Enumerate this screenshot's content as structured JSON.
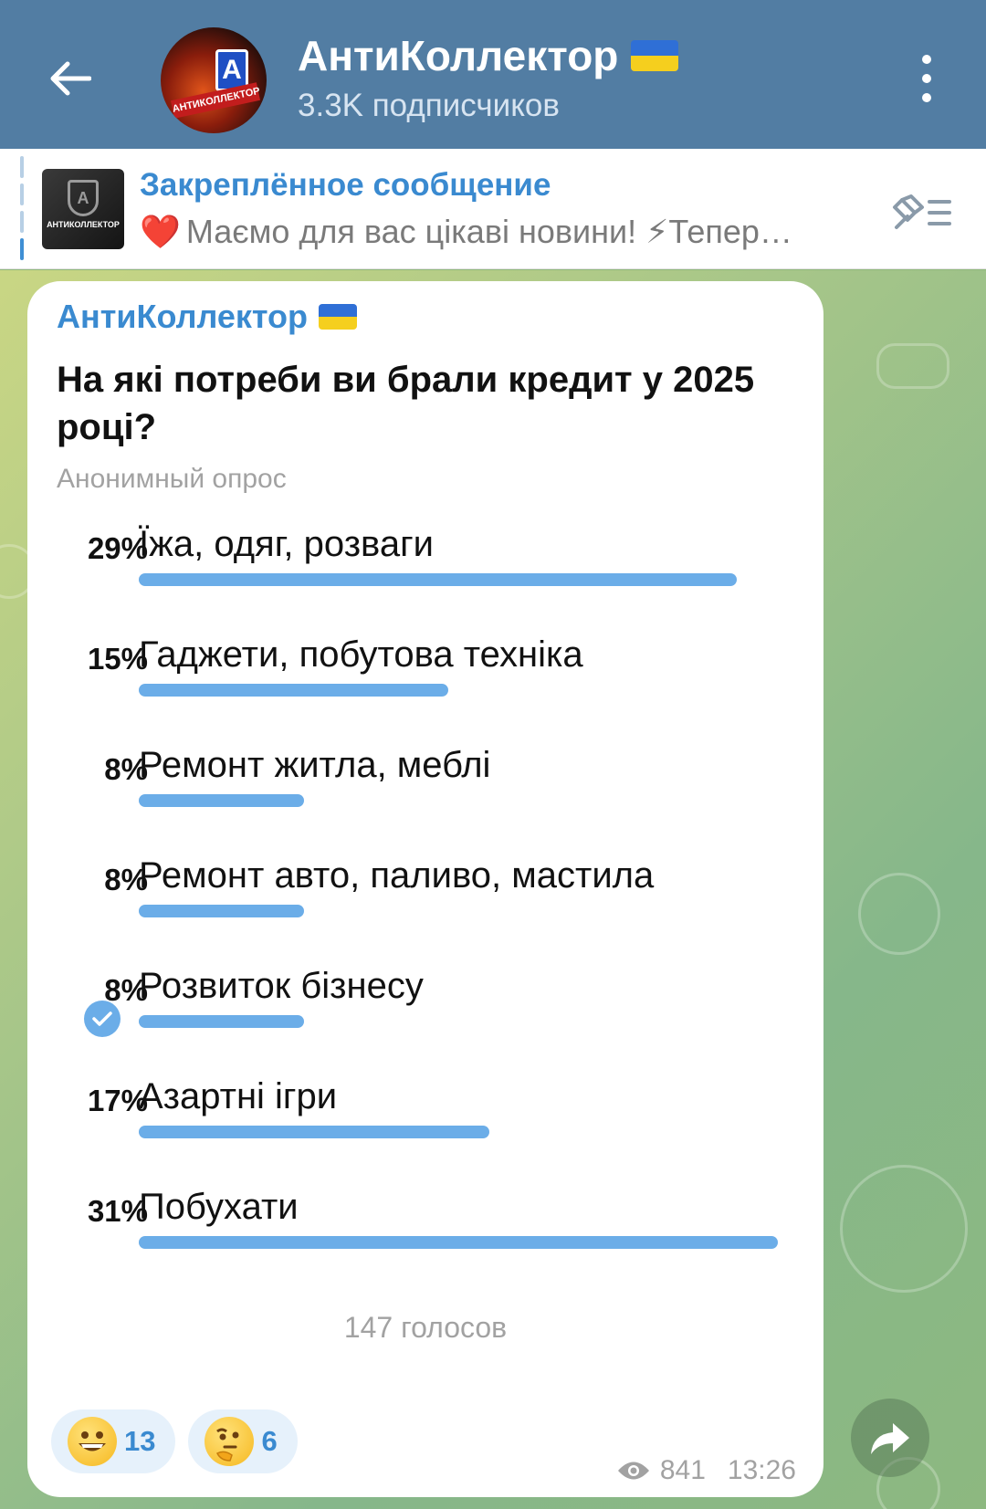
{
  "header": {
    "title": "АнтиКоллектор",
    "subscribers": "3.3K подписчиков",
    "avatar_badge": "A",
    "avatar_stripe": "АНТИКОЛЛЕКТОР",
    "back_icon": "arrow-left-icon",
    "menu_icon": "more-vertical-icon",
    "color": "#527da3"
  },
  "pinned": {
    "title": "Закреплённое сообщение",
    "text": "Маємо для вас цікаві новини! ⚡Тепер…",
    "heart": "❤️",
    "thumb_badge": "A",
    "thumb_label": "АНТИКОЛЛЕКТОР",
    "list_icon": "pinned-list-icon"
  },
  "message": {
    "author": "АнтиКоллектор",
    "question": "На які потреби ви брали кредит у 2025 році?",
    "poll_type": "Анонимный опрос",
    "options": [
      {
        "percent": "29%",
        "label": "Їжа, одяг, розваги",
        "fraction": 0.29,
        "chosen": false
      },
      {
        "percent": "15%",
        "label": "Гаджети, побутова техніка",
        "fraction": 0.15,
        "chosen": false
      },
      {
        "percent": "8%",
        "label": "Ремонт житла, меблі",
        "fraction": 0.08,
        "chosen": false
      },
      {
        "percent": "8%",
        "label": "Ремонт авто, паливо, мастила",
        "fraction": 0.08,
        "chosen": false
      },
      {
        "percent": "8%",
        "label": "Розвиток бізнесу",
        "fraction": 0.08,
        "chosen": true
      },
      {
        "percent": "17%",
        "label": "Азартні ігри",
        "fraction": 0.17,
        "chosen": false
      },
      {
        "percent": "31%",
        "label": "Побухати",
        "fraction": 0.31,
        "chosen": false
      }
    ],
    "votes": "147 голосов",
    "reactions": [
      {
        "emoji": "grinning-face-emoji",
        "count": "13"
      },
      {
        "emoji": "thinking-face-emoji",
        "count": "6"
      }
    ],
    "views": "841",
    "time": "13:26",
    "accent": "#6bade8"
  },
  "share_icon": "share-arrow-icon"
}
